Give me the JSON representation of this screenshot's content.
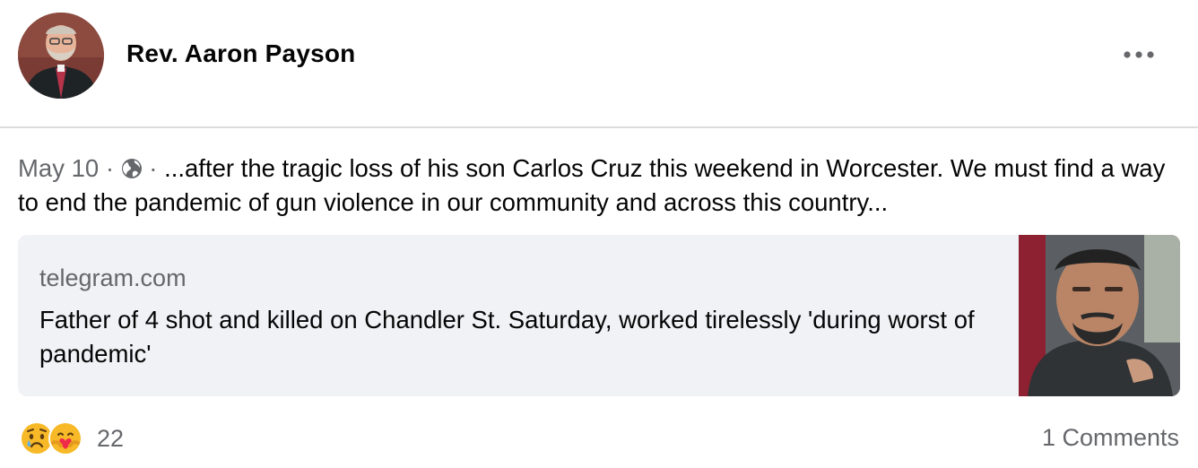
{
  "post": {
    "author": "Rev. Aaron Payson",
    "date": "May 10",
    "separator": "·",
    "privacy_icon": "globe-icon",
    "text": "...after the tragic loss of his son Carlos Cruz this weekend in Worcester. We must find a way to end the pandemic of gun violence in our community and across this country..."
  },
  "link_card": {
    "domain": "telegram.com",
    "title": "Father of 4 shot and killed on Chandler St. Saturday, worked tirelessly 'during worst of pandemic'"
  },
  "reactions": {
    "icons": [
      "sad-emoji-icon",
      "care-emoji-icon"
    ],
    "count": "22"
  },
  "comments_label": "1 Comments",
  "colors": {
    "secondary_text": "#65676b",
    "card_background": "#f0f2f5",
    "divider": "#dcdcdc"
  }
}
